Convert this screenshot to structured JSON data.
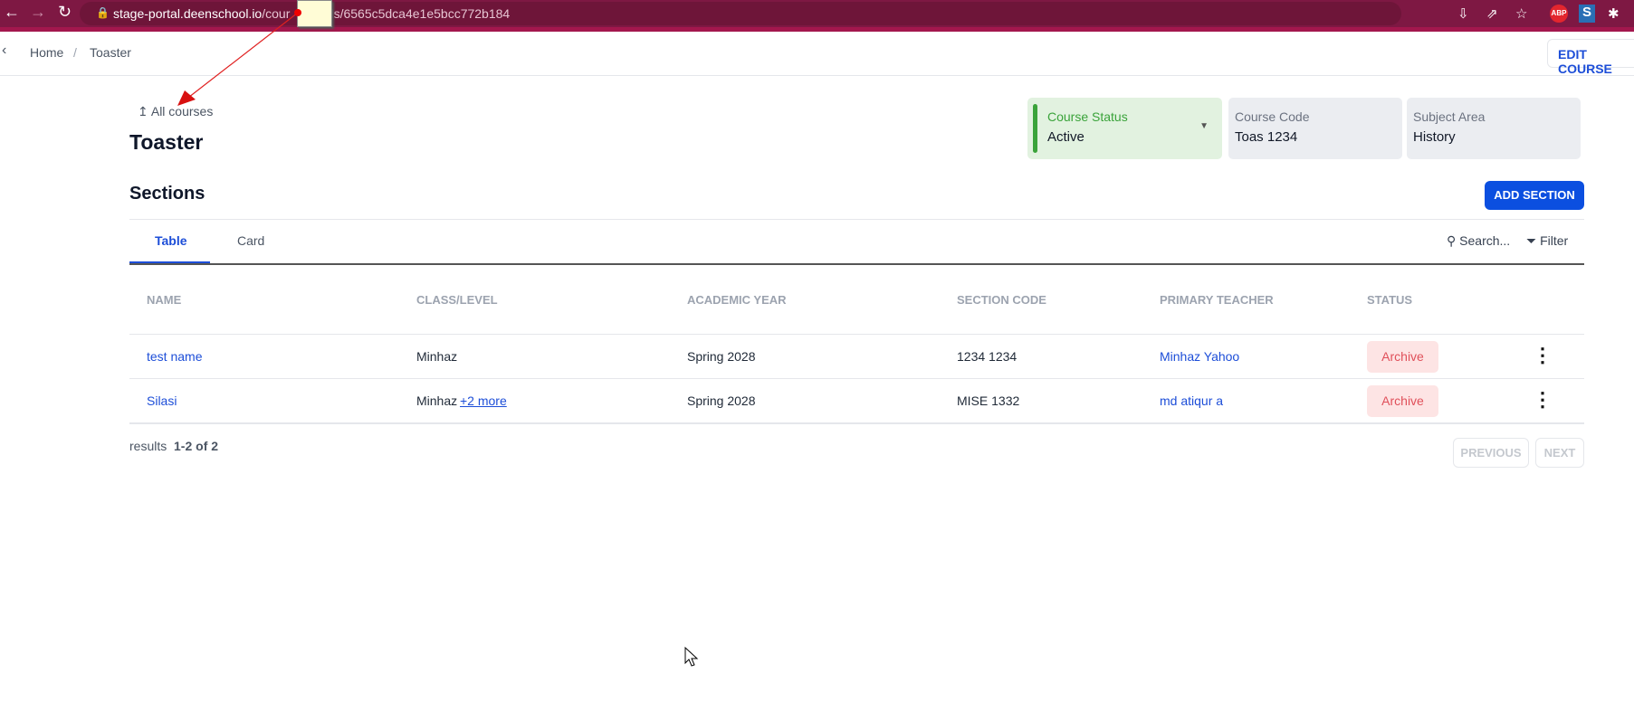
{
  "browser": {
    "url_host": "stage-portal.deenschool.io",
    "url_path_visible_start": "/cour",
    "url_path_visible_end": "ils/6565c5dca4e1e5bcc772b184",
    "ext_abp": "ABP",
    "ext_s": "S"
  },
  "breadcrumb": {
    "items": [
      "Home",
      "Toaster"
    ],
    "separator": "/"
  },
  "header": {
    "edit_label": "EDIT COURSE"
  },
  "page": {
    "back_link": "All courses",
    "title": "Toaster"
  },
  "cards": {
    "status": {
      "label": "Course Status",
      "value": "Active"
    },
    "code": {
      "label": "Course Code",
      "value": "Toas 1234"
    },
    "subject": {
      "label": "Subject Area",
      "value": "History"
    }
  },
  "sections": {
    "heading": "Sections",
    "add_label": "ADD SECTION",
    "tabs": [
      "Table",
      "Card"
    ],
    "search_placeholder": "Search...",
    "filter_label": "Filter"
  },
  "table": {
    "columns": [
      "NAME",
      "CLASS/LEVEL",
      "ACADEMIC YEAR",
      "SECTION CODE",
      "PRIMARY TEACHER",
      "STATUS"
    ],
    "rows": [
      {
        "name": "test name",
        "class": "Minhaz",
        "more": "",
        "year": "Spring 2028",
        "code": "1234 1234",
        "teacher": "Minhaz Yahoo",
        "status": "Archive"
      },
      {
        "name": "Silasi",
        "class": "Minhaz",
        "more": "+2 more",
        "year": "Spring 2028",
        "code": "MISE 1332",
        "teacher": "md atiqur a",
        "status": "Archive"
      }
    ]
  },
  "pagination": {
    "results_label": "results",
    "range": "1-2 of 2",
    "previous": "PREVIOUS",
    "next": "NEXT"
  }
}
